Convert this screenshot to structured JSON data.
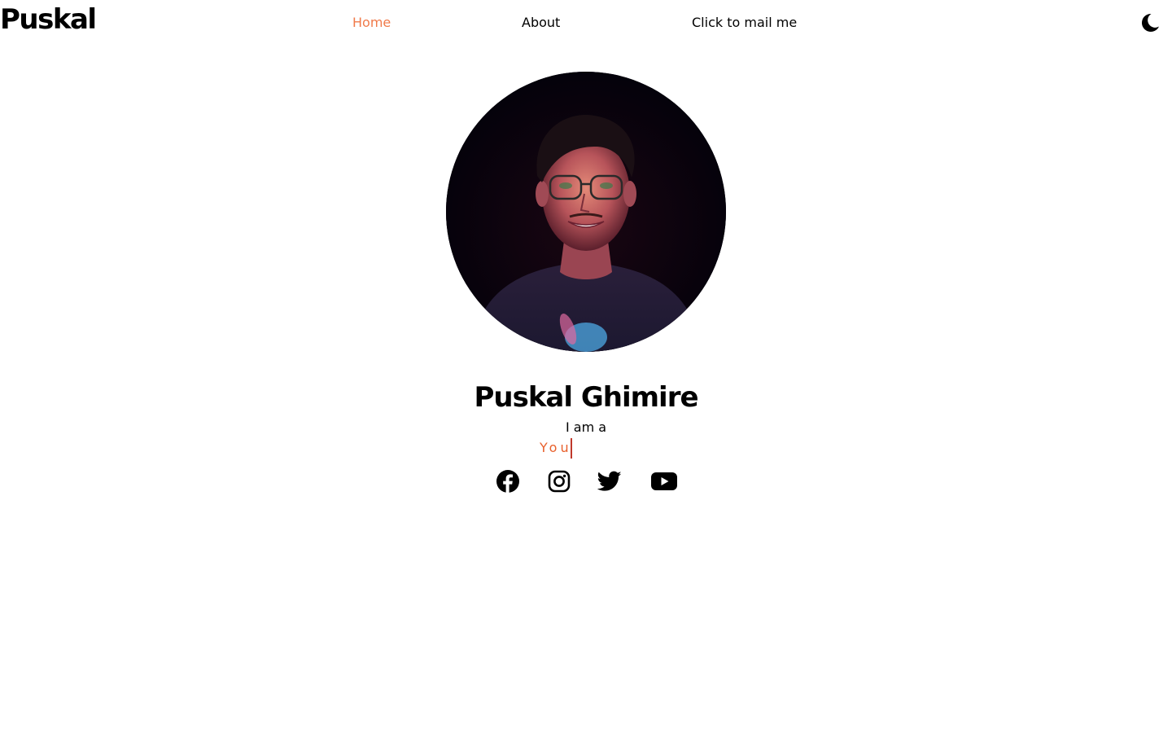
{
  "header": {
    "logo": "Puskal",
    "nav": [
      {
        "label": "Home",
        "active": true
      },
      {
        "label": "About",
        "active": false
      },
      {
        "label": "Click to mail me",
        "active": false
      }
    ],
    "theme_toggle_icon": "moon-icon"
  },
  "hero": {
    "avatar_alt": "profile-photo",
    "name": "Puskal Ghimire",
    "intro": "I am a",
    "typed_text": "You"
  },
  "social": [
    {
      "icon": "facebook-icon"
    },
    {
      "icon": "instagram-icon"
    },
    {
      "icon": "twitter-icon"
    },
    {
      "icon": "youtube-icon"
    }
  ],
  "colors": {
    "accent": "#f07a4a",
    "typed": "#e8602c",
    "text": "#000000",
    "background": "#ffffff"
  }
}
